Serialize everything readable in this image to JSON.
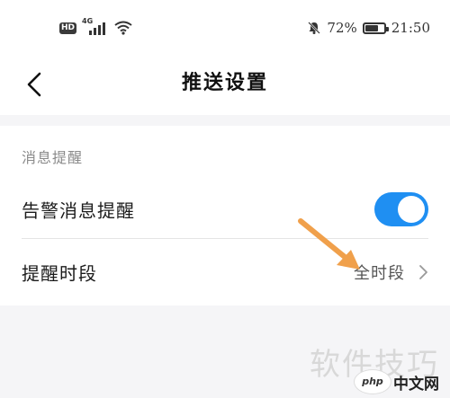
{
  "status_bar": {
    "hd_badge": "HD",
    "network": "4G",
    "battery_text": "72%",
    "battery_level": 0.72,
    "time": "21:50"
  },
  "header": {
    "back_icon": "chevron-left-icon",
    "title": "推送设置"
  },
  "section": {
    "label": "消息提醒"
  },
  "rows": [
    {
      "label": "告警消息提醒",
      "control": "toggle",
      "enabled": true
    },
    {
      "label": "提醒时段",
      "value": "全时段",
      "control": "chevron-right-icon"
    }
  ],
  "colors": {
    "toggle_on": "#1f8ff2",
    "annotation_arrow": "#f0a04b"
  },
  "watermark": {
    "text": "软件技巧",
    "logo_badge": "php",
    "logo_site": "中文网"
  }
}
